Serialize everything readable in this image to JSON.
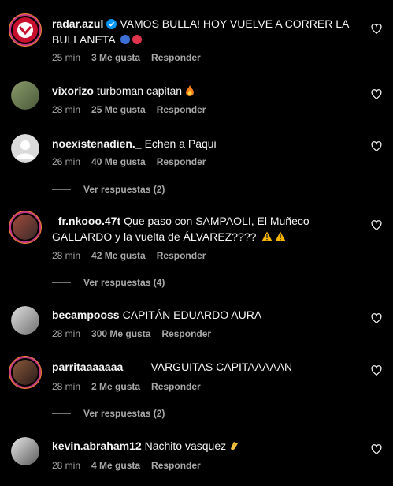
{
  "comments": [
    {
      "username": "radar.azul",
      "verified": true,
      "text": "VAMOS BULLA! HOY VUELVE A CORRER LA BULLANETA",
      "emojis": [
        "blue-circle",
        "red-circle"
      ],
      "time": "25 min",
      "likes": "3 Me gusta",
      "reply": "Responder",
      "avatar_color": "#c8102e"
    },
    {
      "username": "vixorizo",
      "text": "turboman capitan",
      "emojis": [
        "fire"
      ],
      "time": "28 min",
      "likes": "25 Me gusta",
      "reply": "Responder",
      "avatar_color": "#6b7a5a"
    },
    {
      "username": "noexistenadien._",
      "text": "Echen a Paqui",
      "time": "26 min",
      "likes": "40 Me gusta",
      "reply": "Responder",
      "avatar_color": "#dbdbdb",
      "replies_label": "Ver respuestas (2)"
    },
    {
      "username": "_fr.nkooo.47t",
      "text": "Que paso con SAMPAOLI, El Muñeco GALLARDO y la vuelta de ÁLVAREZ????",
      "emojis": [
        "warning",
        "warning"
      ],
      "time": "28 min",
      "likes": "42 Me gusta",
      "reply": "Responder",
      "avatar_color": "#7a3b2e",
      "replies_label": "Ver respuestas (4)"
    },
    {
      "username": "becampooss",
      "text": "CAPITÁN EDUARDO AURA",
      "time": "28 min",
      "likes": "300 Me gusta",
      "reply": "Responder",
      "avatar_color": "#bfbfbf"
    },
    {
      "username": "parritaaaaaaa____",
      "text": "VARGUITAS CAPITAAAAAN",
      "time": "28 min",
      "likes": "2 Me gusta",
      "reply": "Responder",
      "avatar_color": "#5a3a2a",
      "replies_label": "Ver respuestas (2)"
    },
    {
      "username": "kevin.abraham12",
      "text": "Nachito vasquez",
      "emojis": [
        "clap"
      ],
      "time": "28 min",
      "likes": "4 Me gusta",
      "reply": "Responder",
      "avatar_color": "#d9d9d9"
    }
  ]
}
